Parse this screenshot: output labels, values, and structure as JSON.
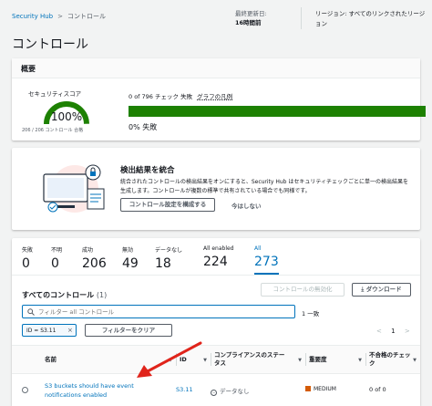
{
  "breadcrumb": {
    "root": "Security Hub",
    "separator": ">",
    "current": "コントロール"
  },
  "last_updated": {
    "label": "最終更新日:",
    "value": "16時間前"
  },
  "region": {
    "label": "リージョン: すべてのリンクされたリージョン"
  },
  "page_title": "コントロール",
  "overview": {
    "heading": "概要",
    "score_label": "セキュリティスコア",
    "score_percent": "100%",
    "score_fraction": 1.0,
    "score_sub": "206 / 206 コントロール 合格",
    "check_text": "0 of 796 チェック 失敗",
    "legend_link": "グラフの凡例",
    "passed_fraction": 1.0,
    "fail_text": "0% 失敗"
  },
  "consolidation": {
    "heading": "検出結果を統合",
    "description": "統合されたコントロールの検出結果をオンにすると、Security Hub はセキュリティチェックごとに単一の検出結果を生成します。コントロールが複数の標準で共有されている場合でも同様です。",
    "configure_button": "コントロール設定を構成する",
    "later_button": "今はしない"
  },
  "stats": [
    {
      "label": "失敗",
      "value": "0"
    },
    {
      "label": "不明",
      "value": "0"
    },
    {
      "label": "成功",
      "value": "206"
    },
    {
      "label": "無効",
      "value": "49"
    },
    {
      "label": "データなし",
      "value": "18"
    },
    {
      "label": "All enabled",
      "value": "224"
    },
    {
      "label": "All",
      "value": "273"
    }
  ],
  "controls": {
    "title": "すべてのコントロール",
    "count": "(1)",
    "disable_button": "コントロールの無効化",
    "download_button": "ダウンロード",
    "search_placeholder": "フィルター all コントロール",
    "match_text": "1 一致",
    "filter_token": "ID = S3.11",
    "clear_button": "フィルターをクリア",
    "pager": {
      "prev": "<",
      "page": "1",
      "next": ">"
    },
    "columns": {
      "name": "名前",
      "id": "ID",
      "compliance": "コンプライアンスのステータス",
      "severity": "重要度",
      "failed": "不合格のチェック"
    },
    "rows": [
      {
        "name": "S3 buckets should have event notifications enabled",
        "id": "S3.11",
        "compliance": "データなし",
        "severity": "MEDIUM",
        "failed": "0 of 0"
      }
    ]
  },
  "colors": {
    "accent": "#0073bb",
    "pass": "#1d8102",
    "medium": "#d45b07",
    "arrow": "#e0241b"
  }
}
